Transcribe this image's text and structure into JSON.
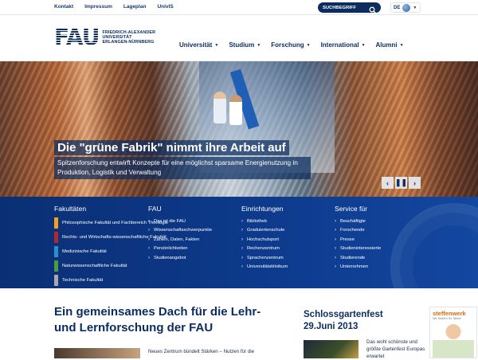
{
  "topbar": {
    "links": [
      "Kontakt",
      "Impressum",
      "Lageplan",
      "UnivIS"
    ],
    "search_placeholder": "SUCHBEGRIFF",
    "language": "DE"
  },
  "header": {
    "logo_mark": "FAU",
    "logo_lines": [
      "FRIEDRICH-ALEXANDER",
      "UNIVERSITÄT",
      "ERLANGEN-NÜRNBERG"
    ],
    "nav": [
      "Universität",
      "Studium",
      "Forschung",
      "International",
      "Alumni"
    ]
  },
  "hero": {
    "title": "Die \"grüne Fabrik\" nimmt ihre Arbeit auf",
    "subtitle": "Spitzenforschung entwirft Konzepte für eine möglichst sparsame Energienutzung in Produktion, Logistik und Verwaltung",
    "controls": [
      "‹",
      "❚❚",
      "›"
    ]
  },
  "band": {
    "fakultaeten": {
      "title": "Fakultäten",
      "items": [
        {
          "label": "Philosophische Fakultät und Fachbereich Theologie",
          "color": "#f4a01a"
        },
        {
          "label": "Rechts- und Wirtschafts-wissenschaftliche Fakultät",
          "color": "#b1282e"
        },
        {
          "label": "Medizinische Fakultät",
          "color": "#2b8ecf"
        },
        {
          "label": "Naturwissenschaftliche Fakultät",
          "color": "#4f9a3a"
        },
        {
          "label": "Technische Fakultät",
          "color": "#a7a9ac"
        }
      ]
    },
    "fau": {
      "title": "FAU",
      "items": [
        "Das ist die FAU",
        "Wissenschaftsschwerpunkte",
        "Zahlen, Daten, Fakten",
        "Persönlichkeiten",
        "Studienangebot"
      ]
    },
    "einrichtungen": {
      "title": "Einrichtungen",
      "items": [
        "Bibliothek",
        "Graduiertenschule",
        "Hochschulsport",
        "Rechenzentrum",
        "Sprachenzentrum",
        "Universitätsklinikum"
      ]
    },
    "service": {
      "title": "Service für",
      "items": [
        "Beschäftigte",
        "Forschende",
        "Presse",
        "Studieninteressierte",
        "Studierende",
        "Unternehmen"
      ]
    }
  },
  "main": {
    "headline": "Ein gemeinsames Dach für die Lehr- und Lernforschung der FAU",
    "teaser": "Neues Zentrum bündelt Stärken – Nutzen für die"
  },
  "sidebar": {
    "title": "Schlossgartenfest 29.Juni 2013",
    "text": "Das wohl schönste und größte Gartenfest Europas erwartet",
    "ad_title": "steffenwerk",
    "ad_sub": "Wir fördern Ihr Talent"
  }
}
